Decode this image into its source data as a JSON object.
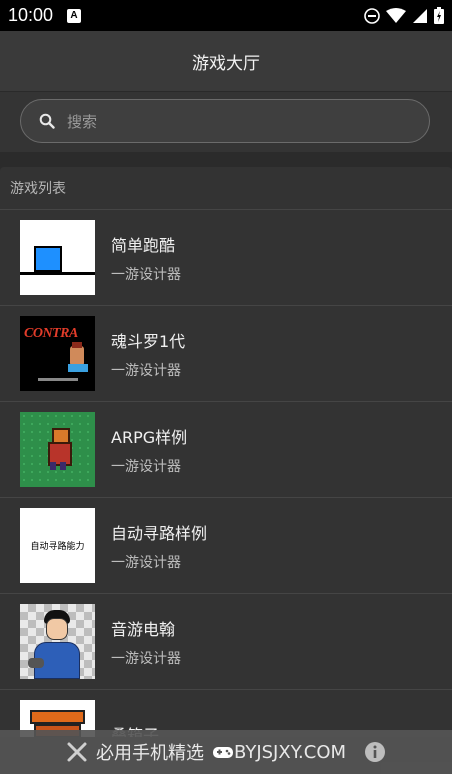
{
  "status_bar": {
    "time": "10:00",
    "notification_letter": "A"
  },
  "app_bar": {
    "title": "游戏大厅"
  },
  "search": {
    "placeholder": "搜索"
  },
  "list": {
    "section_title": "游戏列表",
    "items": [
      {
        "title": "简单跑酷",
        "subtitle": "一游设计器",
        "thumb": "parkour"
      },
      {
        "title": "魂斗罗1代",
        "subtitle": "一游设计器",
        "thumb": "contra",
        "thumb_caption": "CONTRA"
      },
      {
        "title": "ARPG样例",
        "subtitle": "一游设计器",
        "thumb": "arpg"
      },
      {
        "title": "自动寻路样例",
        "subtitle": "一游设计器",
        "thumb": "pathfind",
        "thumb_caption": "自动寻路能力"
      },
      {
        "title": "音游电翰",
        "subtitle": "一游设计器",
        "thumb": "music"
      },
      {
        "title": "叠箱子",
        "subtitle": "",
        "thumb": "boxes"
      }
    ]
  },
  "footer": {
    "text": "必用手机精选",
    "site": "BYJSJXY.COM"
  },
  "colors": {
    "accent_blue": "#1e90ff",
    "background": "#2b2b2b"
  }
}
